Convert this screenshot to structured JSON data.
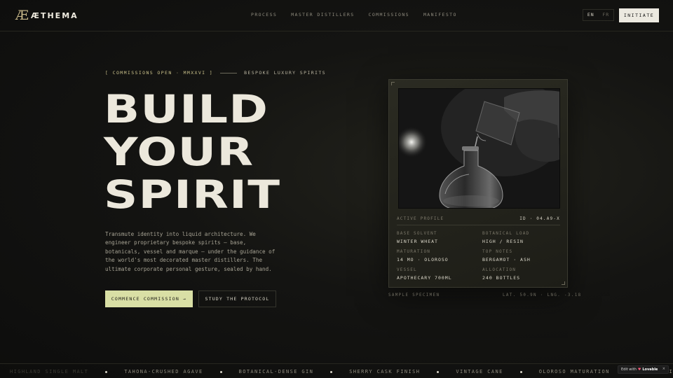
{
  "brand": {
    "mark": "Æ",
    "name": "ÆTHEMA"
  },
  "nav": {
    "links": [
      "PROCESS",
      "MASTER DISTILLERS",
      "COMMISSIONS",
      "MANIFESTO"
    ],
    "lang_active": "EN",
    "lang_other": "FR",
    "cta": "INITIATE"
  },
  "hero": {
    "eyebrow_left": "[ COMMISSIONS OPEN · MMXXVI ]",
    "eyebrow_right": "BESPOKE LUXURY SPIRITS",
    "headline": [
      "BUILD",
      "YOUR",
      "SPIRIT"
    ],
    "lede": "Transmute identity into liquid architecture. We engineer proprietary bespoke spirits — base, botanicals, vessel and marque — under the guidance of the world's most decorated master distillers. The ultimate corporate personal gesture, sealed by hand.",
    "primary_cta": "COMMENCE COMMISSION →",
    "secondary_cta": "STUDY THE PROTOCOL"
  },
  "card": {
    "profile_label": "ACTIVE PROFILE",
    "profile_id": "ID · 04.A9-X",
    "specs": [
      {
        "key": "BASE SOLVENT",
        "value": "WINTER WHEAT"
      },
      {
        "key": "BOTANICAL LOAD",
        "value": "HIGH / RESIN"
      },
      {
        "key": "MATURATION",
        "value": "14 MO · OLOROSO"
      },
      {
        "key": "TOP NOTES",
        "value": "BERGAMOT · ASH"
      },
      {
        "key": "VESSEL",
        "value": "APOTHECARY 700ML"
      },
      {
        "key": "ALLOCATION",
        "value": "240 BOTTLES"
      }
    ],
    "caption_left": "SAMPLE SPECIMEN",
    "caption_right": "LAT. 50.9N · LNG. -3.18"
  },
  "ticker": {
    "items": [
      "HIGHLAND SINGLE MALT",
      "TAHONA-CRUSHED AGAVE",
      "BOTANICAL-DENSE GIN",
      "SHERRY CASK FINISH",
      "VINTAGE CANE",
      "OLOROSO MATURATION",
      "HAND-DIPPED SEAL"
    ]
  },
  "badge": {
    "prefix": "Edit with",
    "brand": "Lovable",
    "close": "×"
  }
}
